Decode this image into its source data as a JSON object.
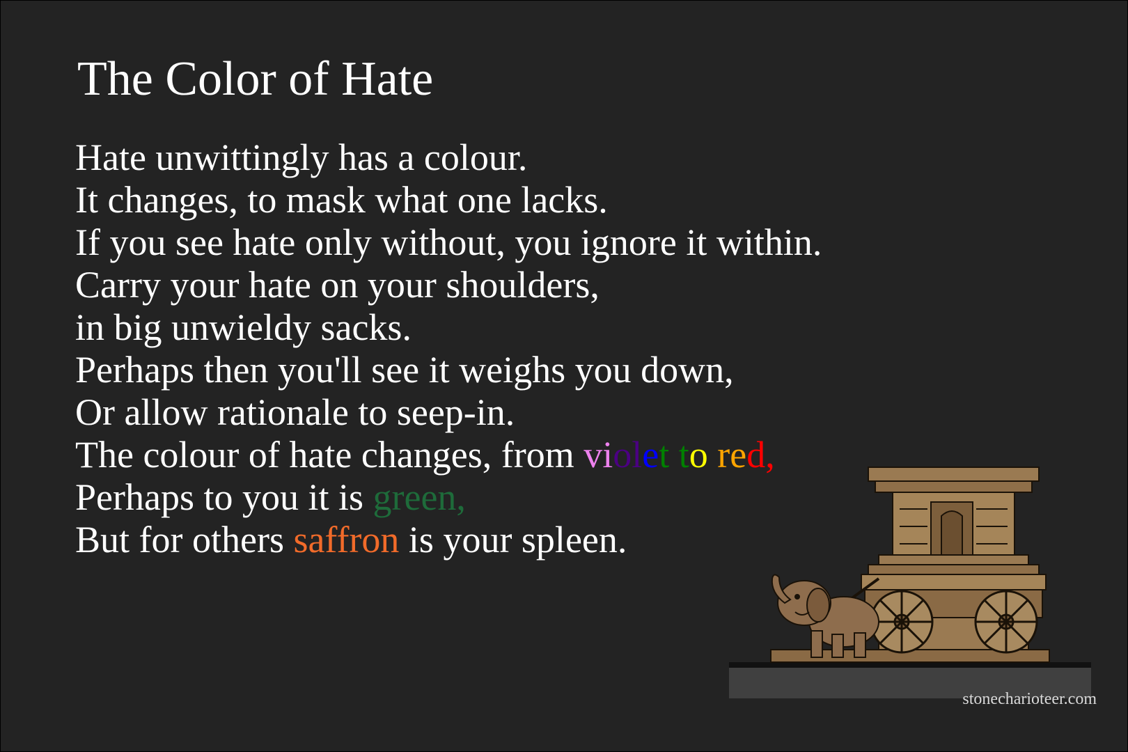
{
  "title": "The Color of Hate",
  "poem": {
    "lines": [
      "Hate unwittingly has a colour.",
      "It changes, to mask what one lacks.",
      "If you see hate only without, you ignore it within.",
      "Carry your hate on your shoulders,",
      "in big unwieldy sacks.",
      "Perhaps then you'll see it weighs you down,",
      "Or allow rationale to seep-in."
    ],
    "line8": {
      "prefix": "The colour of hate changes, from ",
      "rainbow": [
        {
          "text": "v",
          "color": "#ee82ee"
        },
        {
          "text": "i",
          "color": "#ee82ee"
        },
        {
          "text": "o",
          "color": "#4b0082"
        },
        {
          "text": "l",
          "color": "#4b0082"
        },
        {
          "text": "e",
          "color": "#0000ff"
        },
        {
          "text": "t",
          "color": "#008000"
        },
        {
          "text": " ",
          "color": "#ffffff"
        },
        {
          "text": "t",
          "color": "#008000"
        },
        {
          "text": "o",
          "color": "#ffff00"
        },
        {
          "text": " ",
          "color": "#ffffff"
        },
        {
          "text": "r",
          "color": "#ffa500"
        },
        {
          "text": "e",
          "color": "#ffa500"
        },
        {
          "text": "d",
          "color": "#ff0000"
        },
        {
          "text": ",",
          "color": "#ff0000"
        }
      ]
    },
    "line9": {
      "prefix": "Perhaps to you it is ",
      "highlight": "green,",
      "highlight_color": "#1e6b3a"
    },
    "line10": {
      "prefix": "But for others ",
      "highlight": "saffron",
      "highlight_color": "#f26b2a",
      "suffix": " is your spleen."
    }
  },
  "watermark": "stonecharioteer.com",
  "colors": {
    "background": "#232323",
    "text": "#ffffff"
  }
}
